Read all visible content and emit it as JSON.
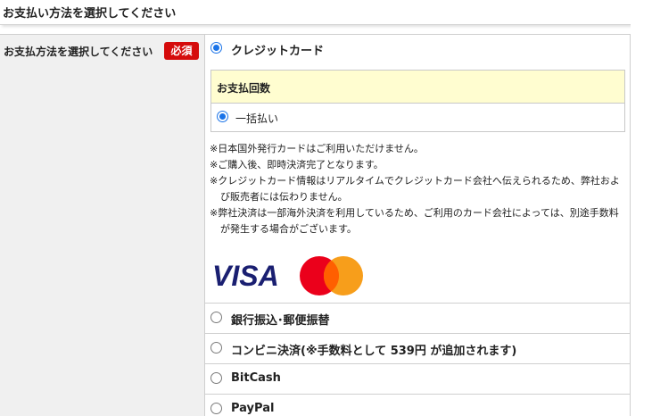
{
  "page": {
    "section_title": "お支払い方法を選択してください"
  },
  "form": {
    "field_label": "お支払方法を選択してください",
    "required_badge": "必須"
  },
  "payment_options": [
    {
      "label": "クレジットカード",
      "selected": true
    },
    {
      "label": "銀行振込･郵便振替",
      "selected": false
    },
    {
      "label": "コンビニ決済(※手数料として 539円 が追加されます)",
      "selected": false
    },
    {
      "label": "BitCash",
      "selected": false
    },
    {
      "label": "PayPal",
      "selected": false
    }
  ],
  "installments": {
    "header": "お支払回数",
    "option_label": "一括払い",
    "selected": true
  },
  "notes": [
    "※日本国外発行カードはご利用いただけません。",
    "※ご購入後、即時決済完了となります。",
    "※クレジットカード情報はリアルタイムでクレジットカード会社へ伝えられるため、弊社および販売者には伝わりません。",
    "※弊社決済は一部海外決済を利用しているため、ご利用のカード会社によっては、別途手数料が発生する場合がございます。"
  ],
  "card_brands": {
    "visa_text": "VISA",
    "visa_color": "#1a1f71",
    "mastercard_red": "#eb001b",
    "mastercard_orange": "#f79e1b",
    "mastercard_overlap": "#ff5f00"
  },
  "colors": {
    "required_badge_bg": "#d50b0b",
    "radio_selected": "#1a73e8",
    "installment_header_bg": "#fffdd0",
    "label_cell_bg": "#f0f0f0"
  }
}
